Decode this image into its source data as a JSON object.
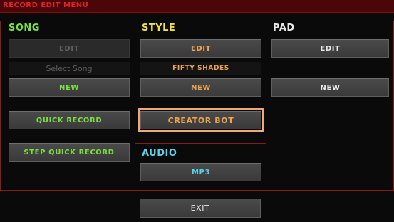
{
  "title": "RECORD EDIT MENU",
  "song": {
    "header": "SONG",
    "edit_label": "EDIT",
    "song_field": "Select Song",
    "new_label": "NEW",
    "quick_record_label": "QUICK RECORD",
    "step_quick_record_label": "STEP QUICK RECORD"
  },
  "style": {
    "header": "STYLE",
    "edit_label": "EDIT",
    "style_name": "FIFTY SHADES",
    "new_label": "NEW",
    "creator_bot_label": "CREATOR BOT"
  },
  "pad": {
    "header": "PAD",
    "edit_label": "EDIT",
    "new_label": "NEW"
  },
  "audio": {
    "header": "AUDIO",
    "mp3_label": "MP3"
  },
  "exit_label": "EXIT",
  "colors": {
    "title_bg": "#4a0608",
    "title_text": "#e02424",
    "frame": "#8a1a1a",
    "song_header": "#7ae03e",
    "style_header": "#f0e040",
    "pad_header": "#e8e8e8",
    "audio_header": "#5bd0e8",
    "selection": "#f0a878"
  }
}
